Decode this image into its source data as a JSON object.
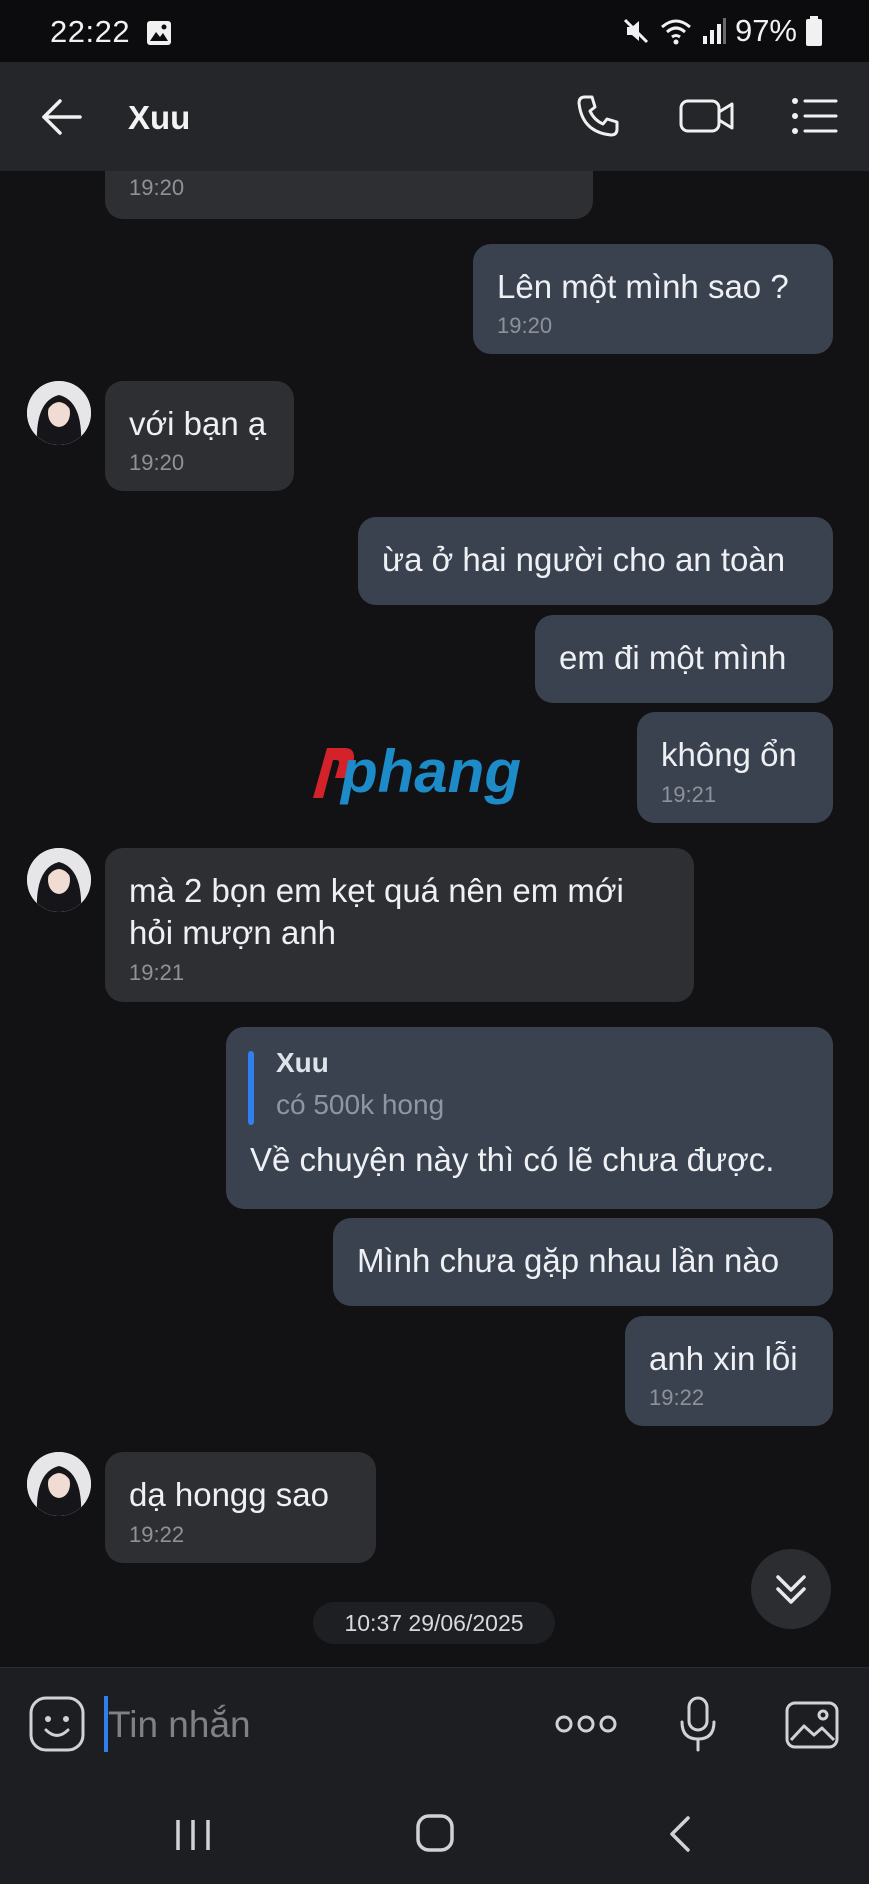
{
  "status_bar": {
    "time": "22:22",
    "battery": "97%"
  },
  "header": {
    "title": "Xuu",
    "icons": [
      "back-arrow-icon",
      "phone-icon",
      "video-camera-icon",
      "menu-list-icon"
    ]
  },
  "messages": [
    {
      "side": "in",
      "text": "",
      "time": "19:20",
      "partial": true
    },
    {
      "side": "out",
      "text": "Lên một mình sao ?",
      "time": "19:20"
    },
    {
      "side": "in",
      "text": "với bạn ạ",
      "time": "19:20"
    },
    {
      "side": "out",
      "text": "ừa ở hai người cho an toàn",
      "time": ""
    },
    {
      "side": "out",
      "text": "em đi một mình",
      "time": ""
    },
    {
      "side": "out",
      "text": "không ổn",
      "time": "19:21"
    },
    {
      "side": "in",
      "lines": [
        "mà 2 bọn em kẹt quá nên em mới",
        "hỏi mượn anh"
      ],
      "time": "19:21"
    },
    {
      "side": "out",
      "quote": {
        "name": "Xuu",
        "text": "có 500k hong"
      },
      "text": "Về chuyện này thì có lẽ chưa được.",
      "time": ""
    },
    {
      "side": "out",
      "text": "Mình chưa gặp nhau lần nào",
      "time": ""
    },
    {
      "side": "out",
      "text": "anh xin lỗi",
      "time": "19:22"
    },
    {
      "side": "in",
      "text": "dạ hongg sao",
      "time": "19:22"
    }
  ],
  "watermark": {
    "text": "phang"
  },
  "date_chip": "10:37 29/06/2025",
  "composer": {
    "placeholder": "Tin nhắn",
    "value": ""
  },
  "colors": {
    "outgoing_bubble": "#3a4250",
    "incoming_bubble": "#2e2f33",
    "quote_accent": "#2f80ed",
    "background": "#121214"
  }
}
